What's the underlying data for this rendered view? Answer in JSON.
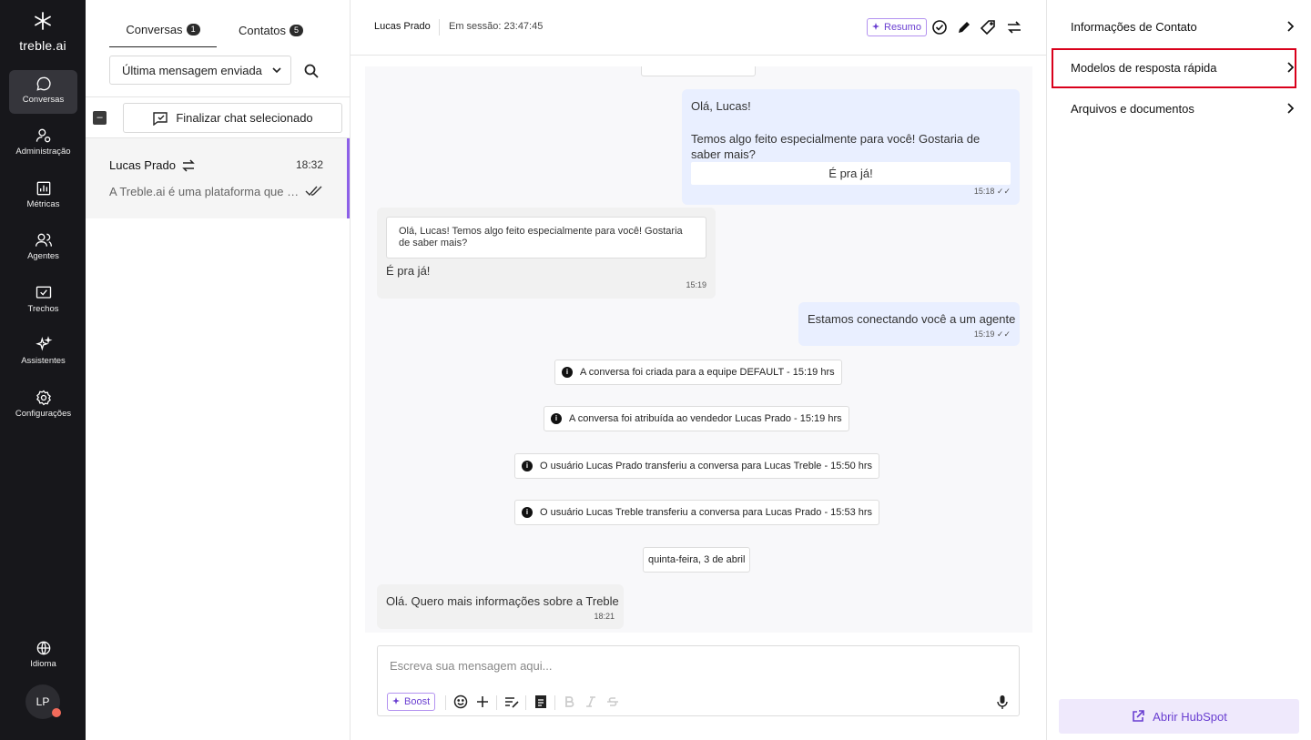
{
  "brand": {
    "name": "treble.ai",
    "logo_icon": "snowflake-asterisk"
  },
  "rail": {
    "items": [
      {
        "label": "Conversas",
        "icon": "chat-bubble-icon"
      },
      {
        "label": "Administração",
        "icon": "user-settings-icon"
      },
      {
        "label": "Métricas",
        "icon": "bar-chart-icon"
      },
      {
        "label": "Agentes",
        "icon": "users-icon"
      },
      {
        "label": "Trechos",
        "icon": "checkbox-message-icon"
      },
      {
        "label": "Assistentes",
        "icon": "sparkles-icon"
      },
      {
        "label": "Configurações",
        "icon": "gear-icon"
      }
    ],
    "language_label": "Idioma",
    "avatar_initials": "LP",
    "avatar_status_color": "#f26b5b"
  },
  "list": {
    "tab_conversations": "Conversas",
    "tab_conversations_count": "1",
    "tab_contacts": "Contatos",
    "tab_contacts_count": "5",
    "filter_value": "Última mensagem enviada",
    "finalize_label": "Finalizar chat selecionado",
    "conversation": {
      "name": "Lucas Prado",
      "time": "18:32",
      "preview": "A Treble.ai é uma plataforma que permite"
    }
  },
  "chat": {
    "contact_name": "Lucas Prado",
    "session": "Em sessão: 23:47:45",
    "resumo_label": "Resumo",
    "messages": {
      "out1_greeting": "Olá, Lucas!",
      "out1_body": "Temos algo feito especialmente para você! Gostaria de saber mais?",
      "out1_button": "É pra já!",
      "out1_time": "15:18",
      "in1_quote": "Olá, Lucas! Temos algo feito especialmente para você! Gostaria de saber mais?",
      "in1_text": "É pra já!",
      "in1_time": "15:19",
      "out2_text": "Estamos conectando você a um agente",
      "out2_time": "15:19",
      "sys1": "A conversa foi criada para a equipe DEFAULT - 15:19 hrs",
      "sys2": "A conversa foi atribuída ao vendedor Lucas Prado - 15:19 hrs",
      "sys3": "O usuário Lucas Prado transferiu a conversa para Lucas Treble - 15:50 hrs",
      "sys4": "O usuário Lucas Treble transferiu a conversa para Lucas Prado - 15:53 hrs",
      "date_divider": "quinta-feira, 3 de abril",
      "in2_text": "Olá. Quero mais informações sobre a Treble",
      "in2_time": "18:21"
    },
    "composer_placeholder": "Escreva sua mensagem aqui...",
    "boost_label": "Boost"
  },
  "right": {
    "items": [
      {
        "label": "Informações de Contato"
      },
      {
        "label": "Modelos de resposta rápida"
      },
      {
        "label": "Arquivos e documentos"
      }
    ],
    "hubspot_label": "Abrir HubSpot"
  },
  "colors": {
    "accent": "#6a3fd1",
    "rail_bg": "#17171b",
    "highlight": "#d9001b",
    "out_bubble": "#e9efff"
  }
}
